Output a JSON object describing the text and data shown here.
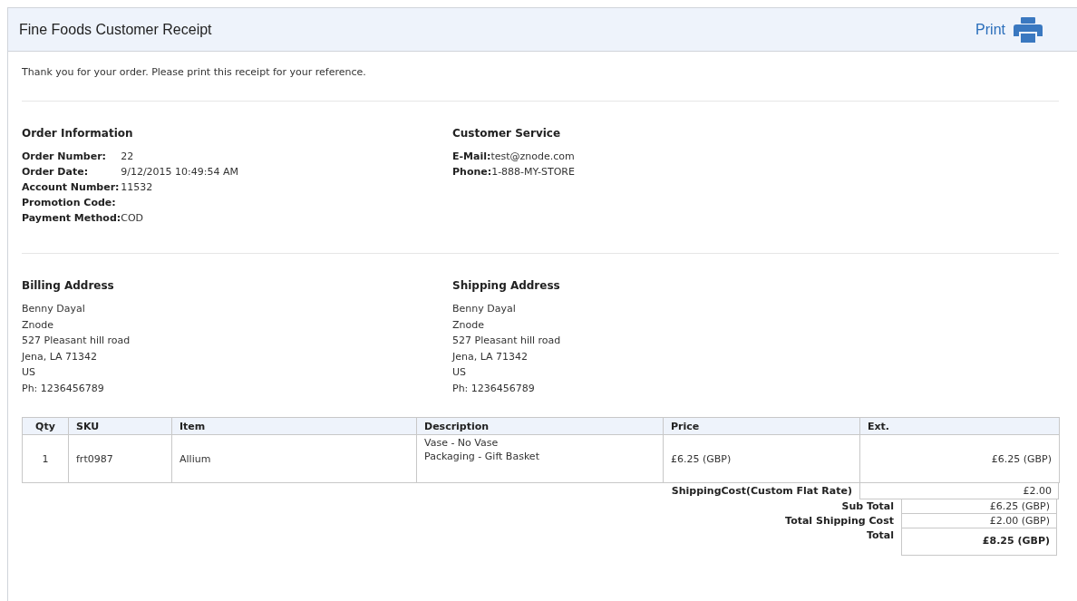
{
  "header": {
    "title": "Fine Foods Customer Receipt",
    "print_link": "Print"
  },
  "intro": "Thank you for your order. Please print this receipt for your reference.",
  "order_information": {
    "heading": "Order Information",
    "fields": [
      {
        "label": "Order Number:",
        "value": "22"
      },
      {
        "label": "Order Date:",
        "value": "9/12/2015 10:49:54 AM"
      },
      {
        "label": "Account Number:",
        "value": "11532"
      },
      {
        "label": "Promotion Code:"
      },
      {
        "label": "Payment Method:",
        "value": "COD"
      }
    ]
  },
  "customer_service": {
    "heading": "Customer Service",
    "fields": [
      {
        "label": "E-Mail:",
        "value": "test@znode.com"
      },
      {
        "label": "Phone:",
        "value": "1-888-MY-STORE"
      }
    ]
  },
  "billing_address": {
    "heading": "Billing Address",
    "lines": [
      "Benny Dayal",
      "Znode",
      "527 Pleasant hill road",
      "Jena, LA 71342",
      "US",
      "Ph: 1236456789"
    ]
  },
  "shipping_address": {
    "heading": "Shipping Address",
    "lines": [
      "Benny Dayal",
      "Znode",
      "527 Pleasant hill road",
      "Jena, LA 71342",
      "US",
      "Ph: 1236456789"
    ]
  },
  "items_table": {
    "columns": [
      "Qty",
      "SKU",
      "Item",
      "Description",
      "Price",
      "Ext."
    ],
    "rows": [
      {
        "qty": "1",
        "sku": "frt0987",
        "item": "Allium",
        "description": [
          "Vase - No Vase",
          "Packaging - Gift Basket"
        ],
        "price": "£6.25 (GBP)",
        "ext": "£6.25 (GBP)"
      }
    ]
  },
  "shipping_cost": {
    "label": "ShippingCost(Custom Flat Rate)",
    "value": "£2.00"
  },
  "totals": [
    {
      "label": "Sub Total",
      "value": "£6.25 (GBP)",
      "emphasis": false
    },
    {
      "label": "Total Shipping Cost",
      "value": "£2.00 (GBP)",
      "emphasis": false
    },
    {
      "label": "Total",
      "value": "£8.25 (GBP)",
      "emphasis": true
    }
  ]
}
